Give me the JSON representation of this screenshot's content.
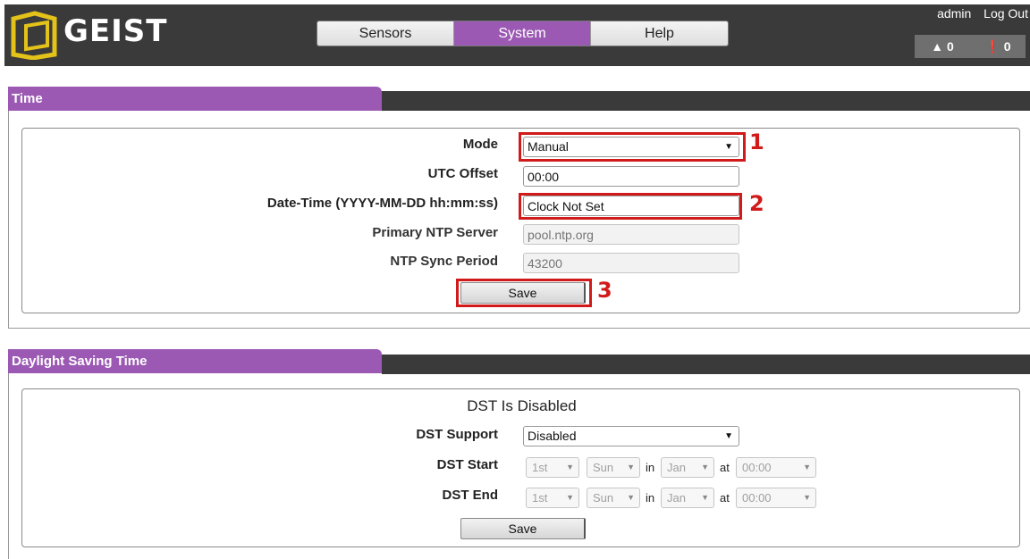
{
  "header": {
    "logo_text": "GEIST",
    "nav_tabs": [
      {
        "label": "Sensors",
        "active": false
      },
      {
        "label": "System",
        "active": true
      },
      {
        "label": "Help",
        "active": false
      }
    ],
    "user": "admin",
    "logout": "Log Out",
    "alarms": "0",
    "warnings": "0"
  },
  "time": {
    "title": "Time",
    "mode": {
      "label": "Mode",
      "value": "Manual"
    },
    "utc_offset": {
      "label": "UTC Offset",
      "value": "00:00"
    },
    "date_time": {
      "label": "Date-Time (YYYY-MM-DD hh:mm:ss)",
      "value": "Clock Not Set"
    },
    "ntp_server": {
      "label": "Primary NTP Server",
      "placeholder": "pool.ntp.org"
    },
    "ntp_sync": {
      "label": "NTP Sync Period",
      "placeholder": "43200"
    },
    "save_label": "Save",
    "callouts": [
      "1",
      "2",
      "3"
    ]
  },
  "dst": {
    "title": "Daylight Saving Time",
    "status": "DST Is Disabled",
    "support": {
      "label": "DST Support",
      "value": "Disabled"
    },
    "start": {
      "label": "DST Start",
      "week": "1st",
      "day": "Sun",
      "in": "in",
      "month": "Jan",
      "at": "at",
      "time": "00:00"
    },
    "end": {
      "label": "DST End",
      "week": "1st",
      "day": "Sun",
      "in": "in",
      "month": "Jan",
      "at": "at",
      "time": "00:00"
    },
    "save_label": "Save"
  },
  "colors": {
    "accent": "#9b59b3",
    "header": "#3a3a3a",
    "callout": "#d11a1a"
  }
}
